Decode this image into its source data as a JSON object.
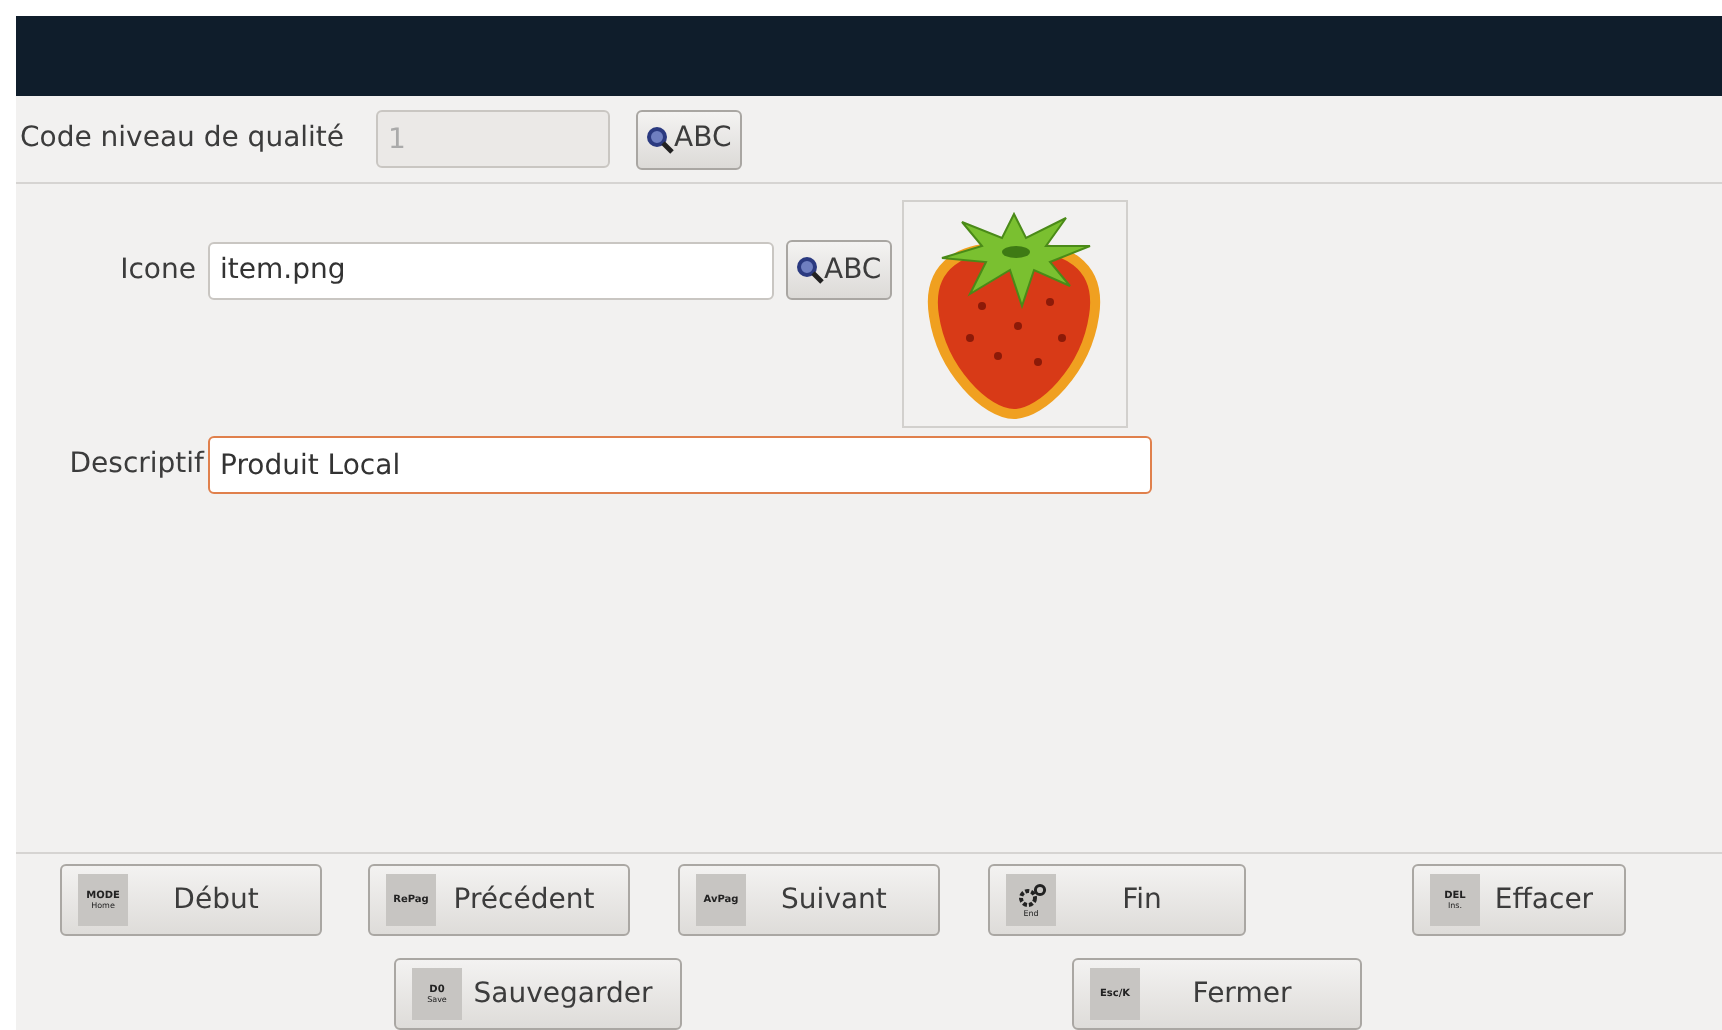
{
  "header": {
    "code_field": {
      "label": "Code niveau de qualité",
      "value": "1",
      "disabled": true,
      "search_button": "ABC"
    }
  },
  "form": {
    "icon_field": {
      "label": "Icone",
      "value": "item.png",
      "search_button": "ABC"
    },
    "description_field": {
      "label": "Descriptif",
      "value": "Produit Local",
      "focused": true
    }
  },
  "buttons": [
    {
      "label": "Début",
      "key": "MODE",
      "key_sub": "Home",
      "kind": "text"
    },
    {
      "label": "Précédent",
      "key": "RePag",
      "kind": "text"
    },
    {
      "label": "Suivant",
      "key": "AvPag",
      "kind": "text"
    },
    {
      "label": "Fin",
      "key_sub": "End",
      "kind": "gear"
    },
    {
      "label": "Effacer",
      "key": "DEL",
      "key_sub": "Ins.",
      "kind": "text"
    }
  ],
  "buttons_row_2": [
    {
      "label": "Sauvegarder",
      "key": "D0",
      "key_sub": "Save"
    },
    {
      "label": "Fermer",
      "key": "Esc/K"
    }
  ]
}
